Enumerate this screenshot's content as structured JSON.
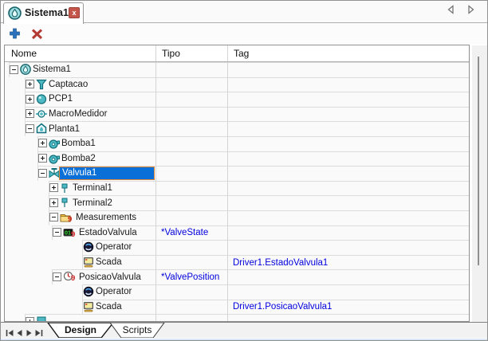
{
  "doc_tab": {
    "title": "Sistema1",
    "close_glyph": "x"
  },
  "tab_scroll": {
    "left": "left",
    "right": "right"
  },
  "toolbar": {
    "buttons": [
      {
        "id": "add",
        "icon": "plus-icon"
      },
      {
        "id": "delete",
        "icon": "delete-x-icon"
      }
    ]
  },
  "grid": {
    "columns": [
      {
        "label": "Nome"
      },
      {
        "label": "Tipo"
      },
      {
        "label": "Tag"
      }
    ],
    "rows": [
      {
        "name": "Sistema1",
        "level": 0,
        "expand": "minus",
        "icon": "drop-circle",
        "tipo": "",
        "tag": ""
      },
      {
        "name": "Captacao",
        "level": 1,
        "expand": "plus",
        "icon": "funnel",
        "tipo": "",
        "tag": ""
      },
      {
        "name": "PCP1",
        "level": 1,
        "expand": "plus",
        "icon": "sphere",
        "tipo": "",
        "tag": ""
      },
      {
        "name": "MacroMedidor",
        "level": 1,
        "expand": "plus",
        "icon": "flow-meter",
        "tipo": "",
        "tag": ""
      },
      {
        "name": "Planta1",
        "level": 1,
        "expand": "minus",
        "icon": "plant-house",
        "tipo": "",
        "tag": ""
      },
      {
        "name": "Bomba1",
        "level": 2,
        "expand": "plus",
        "icon": "pump",
        "tipo": "",
        "tag": ""
      },
      {
        "name": "Bomba2",
        "level": 2,
        "expand": "plus",
        "icon": "pump",
        "tipo": "",
        "tag": ""
      },
      {
        "name": "Valvula1",
        "level": 2,
        "expand": "minus",
        "icon": "valve",
        "tipo": "",
        "tag": "",
        "selected": true
      },
      {
        "name": "Terminal1",
        "level": 3,
        "expand": "plus",
        "icon": "terminal",
        "tipo": "",
        "tag": ""
      },
      {
        "name": "Terminal2",
        "level": 3,
        "expand": "plus",
        "icon": "terminal",
        "tipo": "",
        "tag": ""
      },
      {
        "name": "Measurements",
        "level": 3,
        "expand": "minus",
        "icon": "folder",
        "badge": "9",
        "tipo": "",
        "tag": ""
      },
      {
        "name": "EstadoValvula",
        "level": 4,
        "expand": "minus",
        "icon": "digital-display",
        "badge": "9",
        "tipo": "*ValveState",
        "tag": ""
      },
      {
        "name": "Operator",
        "level": 5,
        "expand": "none",
        "icon": "operator",
        "tipo": "",
        "tag": ""
      },
      {
        "name": "Scada",
        "level": 5,
        "expand": "none",
        "icon": "scada-monitor",
        "tipo": "",
        "tag": "Driver1.EstadoValvula1"
      },
      {
        "name": "PosicaoValvula",
        "level": 4,
        "expand": "minus",
        "icon": "clock-gauge",
        "badge": "9",
        "tipo": "*ValvePosition",
        "tag": ""
      },
      {
        "name": "Operator",
        "level": 5,
        "expand": "none",
        "icon": "operator",
        "tipo": "",
        "tag": ""
      },
      {
        "name": "Scada",
        "level": 5,
        "expand": "none",
        "icon": "scada-monitor",
        "tipo": "",
        "tag": "Driver1.PosicaoValvula1"
      },
      {
        "name": "",
        "level": 1,
        "expand": "plus",
        "icon": "generic",
        "tipo": "",
        "tag": "",
        "partial": true
      }
    ]
  },
  "footer": {
    "nav_buttons": [
      "first",
      "prev",
      "next",
      "last"
    ],
    "tabs": [
      {
        "label": "Design",
        "active": true
      },
      {
        "label": "Scripts",
        "active": false
      }
    ]
  },
  "colors": {
    "selection_bg": "#0A6FD6",
    "selection_border": "#E2883B",
    "link_blue": "#0000DE",
    "badge_red": "#CF1D1D",
    "teal": "#4FB9C4",
    "teal_dark": "#0E6F7A",
    "toolbar_add_blue": "#2B71BC",
    "toolbar_delete_red": "#B33A33"
  }
}
